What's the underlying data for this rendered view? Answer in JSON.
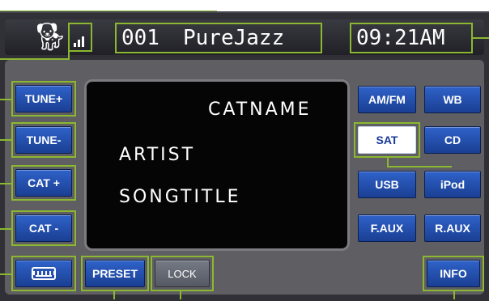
{
  "header": {
    "logo_icon": "dog-logo-icon",
    "signal_icon": "signal-strength-icon",
    "channel_number": "001",
    "channel_name": "PureJazz",
    "clock": "09:21AM"
  },
  "left_buttons": [
    {
      "label": "TUNE+"
    },
    {
      "label": "TUNE-"
    },
    {
      "label": "CAT +"
    },
    {
      "label": "CAT -"
    }
  ],
  "keyboard_button": {
    "icon": "keyboard-icon"
  },
  "display": {
    "category": "CATNAME",
    "artist": "ARTIST",
    "song": "SONGTITLE"
  },
  "right_buttons": {
    "am_fm": "AM/FM",
    "wb": "WB",
    "sat": "SAT",
    "cd": "CD",
    "usb": "USB",
    "ipod": "iPod",
    "f_aux": "F.AUX",
    "r_aux": "R.AUX",
    "info": "INFO"
  },
  "bottom_buttons": {
    "preset": "PRESET",
    "lock": "LOCK"
  },
  "colors": {
    "callout": "#8bb830",
    "button_blue": "#2f62c9",
    "active_button": "#ffffff"
  }
}
